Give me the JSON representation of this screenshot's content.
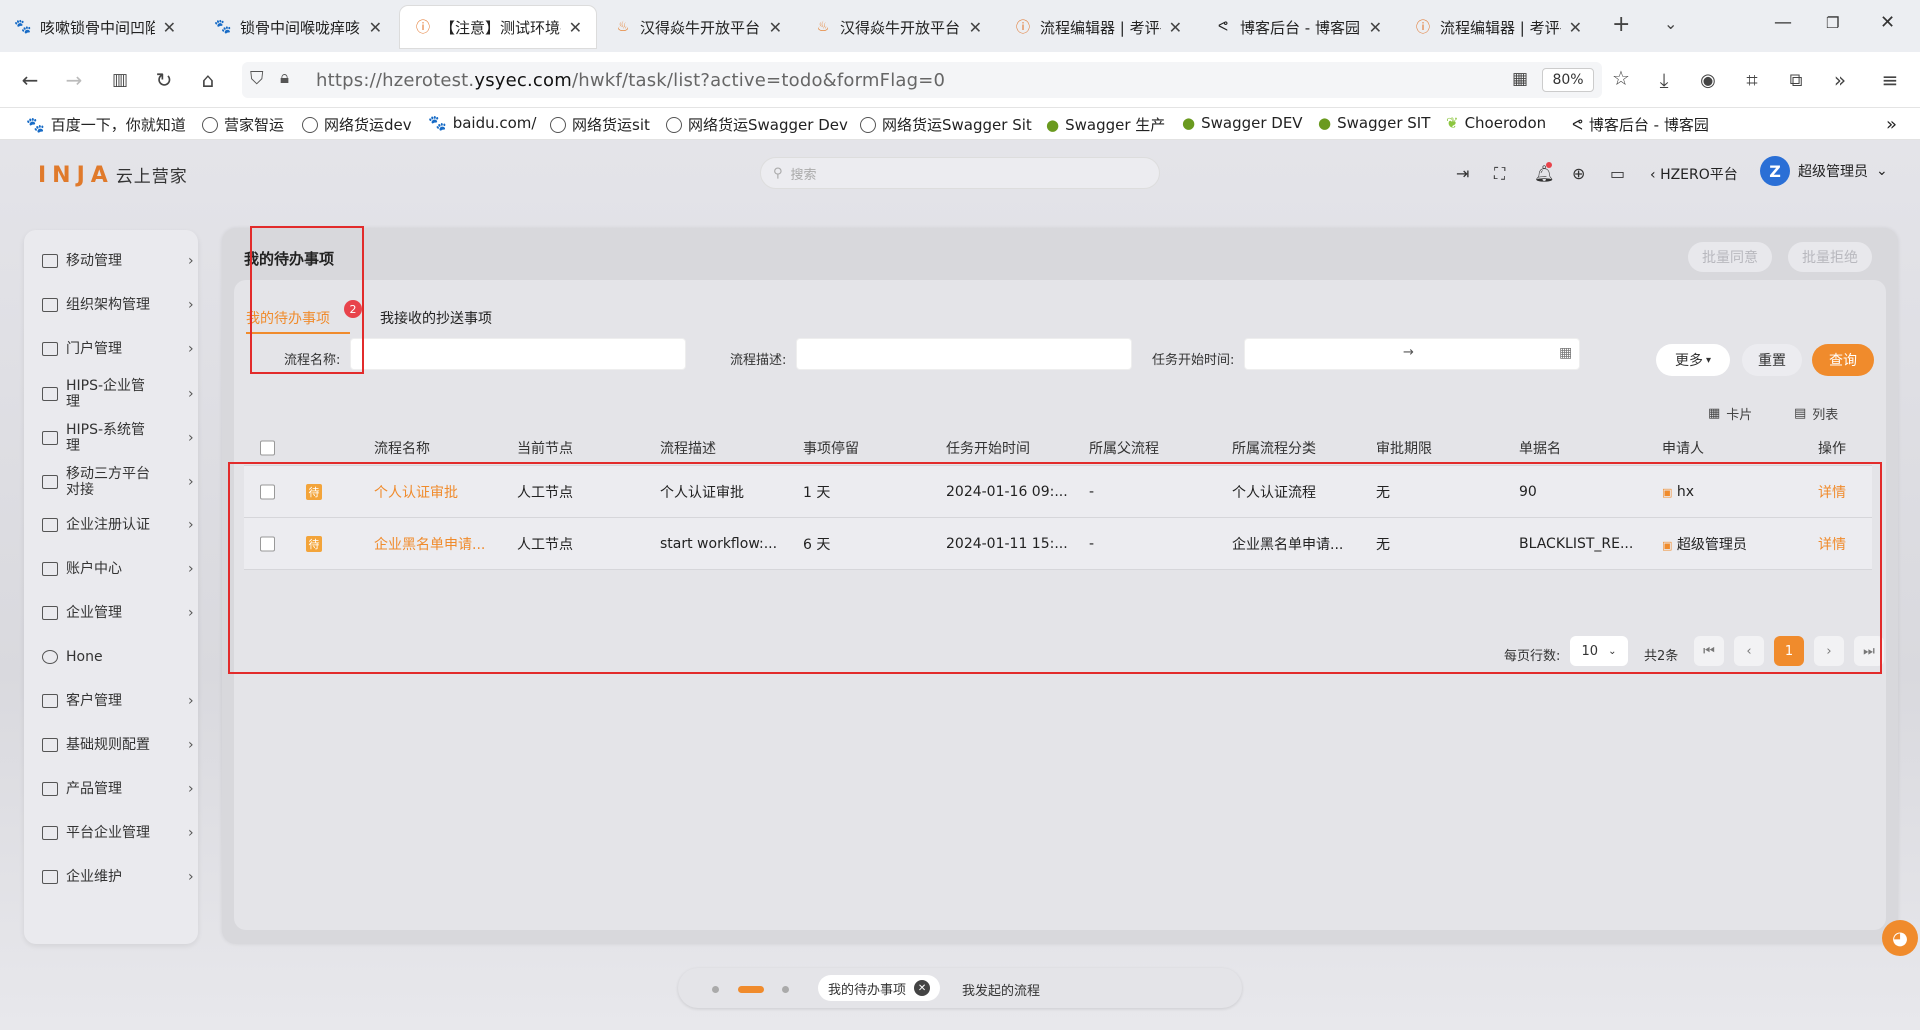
{
  "browser": {
    "tabs": [
      {
        "title": "咳嗽锁骨中间凹陷处",
        "icon": "baidu-paw-icon"
      },
      {
        "title": "锁骨中间喉咙痒咳嗽",
        "icon": "baidu-paw-icon"
      },
      {
        "title": "【注意】测试环境-",
        "icon": "alert-icon"
      },
      {
        "title": "汉得焱牛开放平台",
        "icon": "hand-flame-icon"
      },
      {
        "title": "汉得焱牛开放平台",
        "icon": "hand-flame-icon"
      },
      {
        "title": "流程编辑器 | 考评平",
        "icon": "alert-icon"
      },
      {
        "title": "博客后台 - 博客园",
        "icon": "cnblogs-icon"
      },
      {
        "title": "流程编辑器 | 考评平",
        "icon": "alert-icon"
      }
    ],
    "url_prefix": "https://hzerotest.",
    "url_domain": "ysyec.com",
    "url_path": "/hwkf/task/list?active=todo&formFlag=0",
    "zoom": "80%",
    "bookmarks": [
      "百度一下，你就知道",
      "营家智运",
      "网络货运dev",
      "baidu.com/",
      "网络货运sit",
      "网络货运Swagger Dev",
      "网络货运Swagger Sit",
      "Swagger 生产",
      "Swagger DEV",
      "Swagger SIT",
      "Choerodon",
      "博客后台 - 博客园"
    ]
  },
  "header": {
    "logo": "INJA",
    "logo_text": "云上营家",
    "search_placeholder": "搜索",
    "platform": "HZERO平台",
    "user": "超级管理员",
    "avatar_letter": "Z"
  },
  "sidebar": {
    "items": [
      "移动管理",
      "组织架构管理",
      "门户管理",
      "HIPS-企业管理",
      "HIPS-系统管理",
      "移动三方平台对接",
      "企业注册认证",
      "账户中心",
      "企业管理",
      "Hone",
      "客户管理",
      "基础规则配置",
      "产品管理",
      "平台企业管理",
      "企业维护"
    ]
  },
  "page": {
    "title": "我的待办事项",
    "batch_agree": "批量同意",
    "batch_reject": "批量拒绝",
    "tab_todo": "我的待办事项",
    "tab_todo_count": "2",
    "tab_cc": "我接收的抄送事项",
    "filter_name": "流程名称:",
    "filter_desc": "流程描述:",
    "filter_time": "任务开始时间:",
    "date_arrow": "→",
    "more": "更多",
    "reset": "重置",
    "query": "查询",
    "view_card": "卡片",
    "view_list": "列表"
  },
  "table": {
    "columns": [
      "流程名称",
      "当前节点",
      "流程描述",
      "事项停留",
      "任务开始时间",
      "所属父流程",
      "所属流程分类",
      "审批期限",
      "单据名",
      "申请人",
      "操作"
    ],
    "rows": [
      {
        "tag": "待",
        "name": "个人认证审批",
        "node": "人工节点",
        "desc": "个人认证审批",
        "stay": "1 天",
        "start": "2024-01-16 09:...",
        "parent": "-",
        "category": "个人认证流程",
        "deadline": "无",
        "doc": "90",
        "applicant": "hx",
        "action": "详情"
      },
      {
        "tag": "待",
        "name": "企业黑名单申请...",
        "node": "人工节点",
        "desc": "start workflow:...",
        "stay": "6 天",
        "start": "2024-01-11 15:...",
        "parent": "-",
        "category": "企业黑名单申请...",
        "deadline": "无",
        "doc": "BLACKLIST_RE...",
        "applicant": "超级管理员",
        "action": "详情"
      }
    ]
  },
  "pager": {
    "per_page_label": "每页行数:",
    "per_page": "10",
    "total": "共2条",
    "current": "1"
  },
  "bottom": {
    "tab1": "我的待办事项",
    "tab2": "我发起的流程"
  }
}
